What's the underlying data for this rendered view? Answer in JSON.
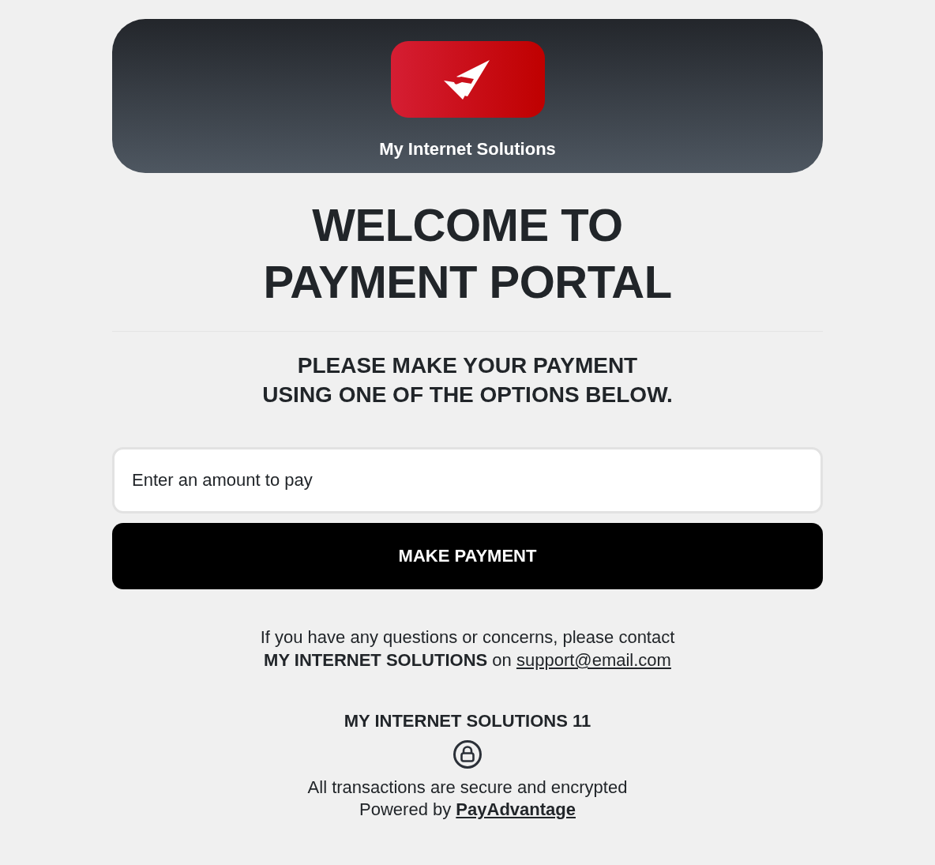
{
  "header": {
    "company": "My Internet Solutions"
  },
  "title_lines": [
    "WELCOME TO",
    "PAYMENT PORTAL"
  ],
  "subtitle_lines": [
    "PLEASE MAKE YOUR PAYMENT",
    "USING ONE OF THE OPTIONS BELOW."
  ],
  "amount_field": {
    "placeholder": "Enter an amount to pay"
  },
  "pay_button": {
    "label": "MAKE PAYMENT"
  },
  "contact": {
    "text": "If you have any questions or concerns, please contact\n**MY INTERNET SOLUTIONS** on",
    "email": "support@email.com"
  },
  "footer": {
    "account": "MY INTERNET SOLUTIONS 11",
    "security_note": "All transactions are secure and encrypted",
    "powered_prefix": "Powered by",
    "powered_link": "PayAdvantage"
  }
}
